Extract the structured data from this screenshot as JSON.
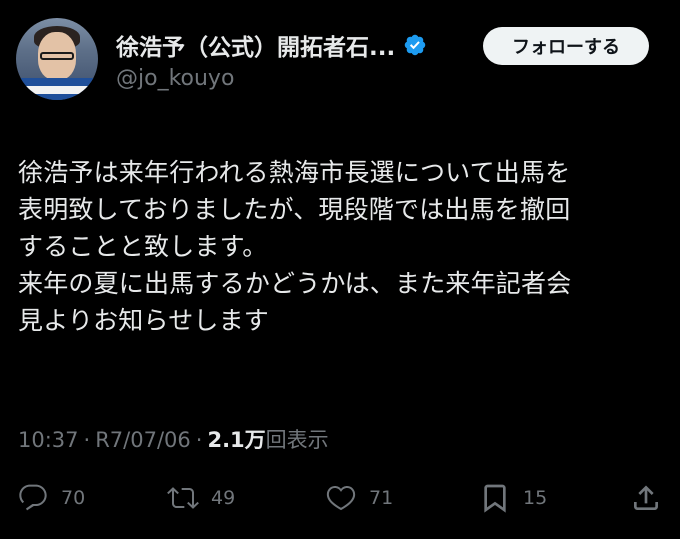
{
  "author": {
    "display_name": "徐浩予（公式）開拓者石...",
    "handle": "@jo_kouyo",
    "verified": true,
    "avatar_icon": "profile-photo"
  },
  "follow_button": {
    "label": "フォローする"
  },
  "tweet": {
    "text": "徐浩予は来年行われる熱海市長選について出馬を\n表明致しておりましたが、現段階では出馬を撤回\nすることと致します。\n来年の夏に出馬するかどうかは、また来年記者会\n見よりお知らせします"
  },
  "meta": {
    "time": "10:37",
    "separator": "·",
    "date": "R7/07/06",
    "views_count": "2.1万",
    "views_label": "回表示"
  },
  "actions": {
    "reply": {
      "icon": "reply-icon",
      "count": "70"
    },
    "retweet": {
      "icon": "retweet-icon",
      "count": "49"
    },
    "like": {
      "icon": "heart-icon",
      "count": "71"
    },
    "bookmark": {
      "icon": "bookmark-icon",
      "count": "15"
    },
    "share": {
      "icon": "share-icon"
    }
  },
  "colors": {
    "background": "#000000",
    "text": "#e7e9ea",
    "secondary": "#71767b",
    "verified": "#1d9bf0",
    "button_bg": "#eff3f4"
  }
}
